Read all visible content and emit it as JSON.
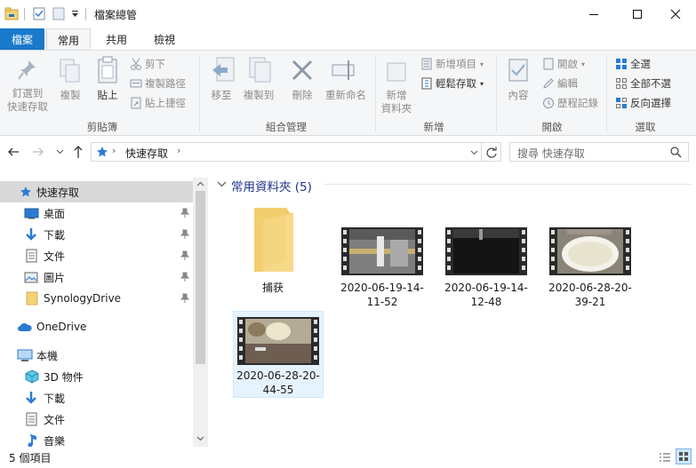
{
  "window": {
    "title": "檔案總管"
  },
  "tabs": {
    "file": "檔案",
    "home": "常用",
    "share": "共用",
    "view": "檢視"
  },
  "ribbon": {
    "pin": "釘選到\n快速存取",
    "copy": "複製",
    "paste": "貼上",
    "cut": "剪下",
    "copy_path": "複製路徑",
    "paste_shortcut": "貼上捷徑",
    "clipboard": "剪貼簿",
    "move_to": "移至",
    "copy_to": "複製到",
    "delete": "刪除",
    "rename": "重新命名",
    "organize": "組合管理",
    "new_folder": "新增\n資料夾",
    "new_item": "新增項目",
    "easy_access": "輕鬆存取",
    "new_group": "新增",
    "properties": "內容",
    "open": "開啟",
    "edit": "編輯",
    "history": "歷程記錄",
    "open_group": "開啟",
    "select_all": "全選",
    "select_none": "全部不選",
    "invert_selection": "反向選擇",
    "select_group": "選取"
  },
  "address": {
    "path": "快速存取",
    "search_placeholder": "搜尋 快速存取"
  },
  "nav": {
    "quick_access": "快速存取",
    "desktop": "桌面",
    "downloads": "下載",
    "documents": "文件",
    "pictures": "圖片",
    "synology": "SynologyDrive",
    "onedrive": "OneDrive",
    "this_pc": "本機",
    "objects3d": "3D 物件",
    "downloads2": "下載",
    "documents2": "文件",
    "music": "音樂"
  },
  "content": {
    "group_header": "常用資料夾 (5)",
    "items": [
      {
        "name": "捕获"
      },
      {
        "name1": "2020-06-19-14-",
        "name2": "11-52"
      },
      {
        "name1": "2020-06-19-14-",
        "name2": "12-48"
      },
      {
        "name1": "2020-06-28-20-",
        "name2": "39-21"
      },
      {
        "name1": "2020-06-28-20-",
        "name2": "44-55"
      }
    ]
  },
  "status": {
    "count": "5 個項目"
  },
  "colors": {
    "accent": "#1979ca",
    "folder": "#f3d27a",
    "selected": "#cce8ff",
    "nav_selected": "#d9d9d9"
  }
}
